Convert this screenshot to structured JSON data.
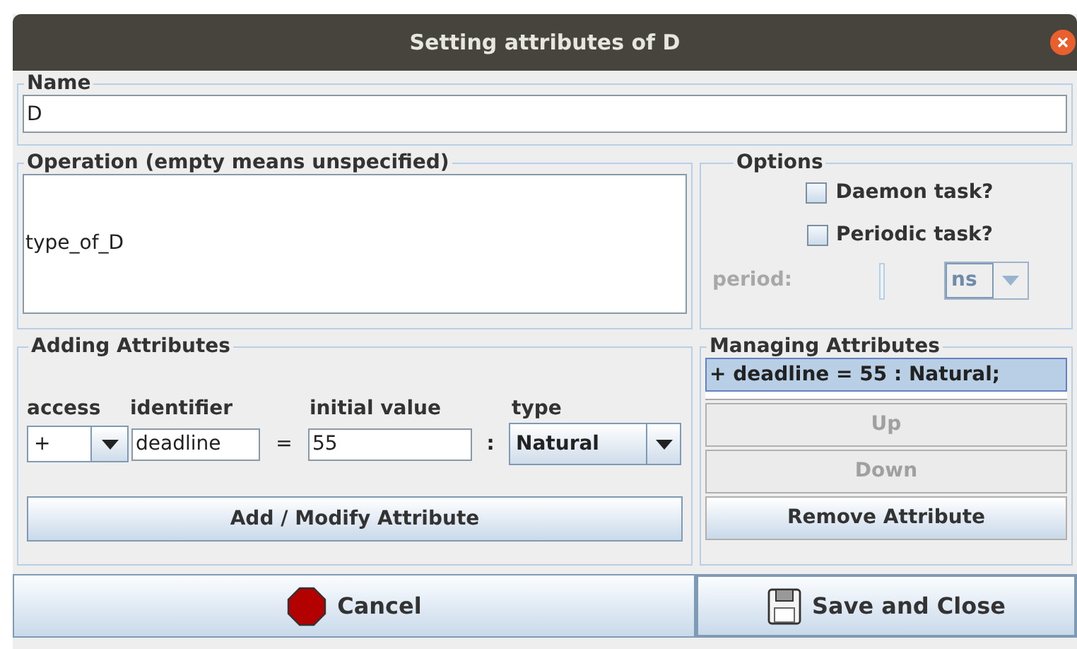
{
  "window": {
    "title": "Setting attributes of D"
  },
  "name": {
    "label": "Name",
    "value": "D"
  },
  "operation": {
    "label": "Operation (empty means unspecified)",
    "value": "type_of_D"
  },
  "options": {
    "label": "Options",
    "checkboxes": [
      {
        "label": "Daemon task?",
        "checked": false
      },
      {
        "label": "Periodic task?",
        "checked": false
      }
    ],
    "period": {
      "label": "period:",
      "unit": "ns",
      "disabled": true
    }
  },
  "adding": {
    "label": "Adding Attributes",
    "access_label": "access",
    "identifier_label": "identifier",
    "initial_value_label": "initial value",
    "type_label": "type",
    "access": "+",
    "identifier": "deadline",
    "equals": "=",
    "initial_value": "55",
    "colon": ":",
    "type": "Natural",
    "button": "Add / Modify Attribute"
  },
  "managing": {
    "label": "Managing Attributes",
    "items": [
      {
        "text": "+ deadline = 55 : Natural;",
        "selected": true
      }
    ],
    "buttons": [
      {
        "label": "Up",
        "disabled": true
      },
      {
        "label": "Down",
        "disabled": true
      },
      {
        "label": "Remove Attribute",
        "disabled": false
      }
    ]
  },
  "footer": [
    {
      "kind": "cancel",
      "label": "Cancel"
    },
    {
      "kind": "save",
      "label": "Save and Close"
    }
  ]
}
